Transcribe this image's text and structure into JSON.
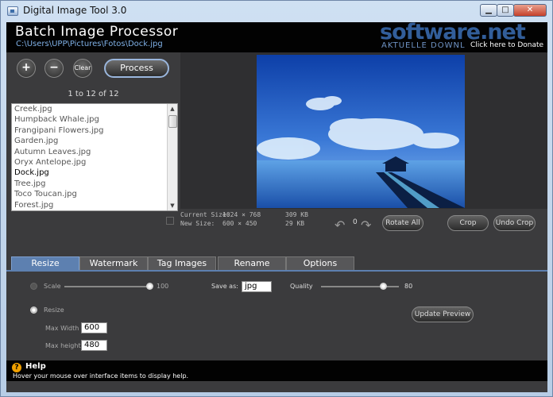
{
  "window": {
    "title": "Digital Image Tool 3.0",
    "min_glyph": "▁",
    "max_glyph": "□",
    "close_glyph": "✕"
  },
  "header": {
    "app_title": "Batch Image Processor",
    "path": "C:\\Users\\UPP\\Pictures\\Fotos\\Dock.jpg",
    "watermark": "software.net",
    "watermark_sub": "AKTUELLE DOWNL",
    "donate": "Click here to Donate"
  },
  "controls": {
    "add": "+",
    "remove": "−",
    "clear": "Clear",
    "process": "Process",
    "counter": "1 to 12 of 12"
  },
  "files": [
    "Creek.jpg",
    "Humpback Whale.jpg",
    "Frangipani Flowers.jpg",
    "Garden.jpg",
    "Autumn Leaves.jpg",
    "Oryx Antelope.jpg",
    "Dock.jpg",
    "Tree.jpg",
    "Toco Toucan.jpg",
    "Forest.jpg"
  ],
  "selected_file": "Dock.jpg",
  "info": {
    "current_label": "Current Size:",
    "current_dims": "1024 × 768",
    "current_size": "309 KB",
    "new_label": "New Size:",
    "new_dims": "600 × 450",
    "new_size": "29 KB",
    "rotation": "0",
    "rotate_all": "Rotate All",
    "crop": "Crop",
    "undo_crop": "Undo Crop"
  },
  "tabs": [
    "Resize",
    "Watermark",
    "Tag Images",
    "Rename",
    "Options"
  ],
  "active_tab": "Resize",
  "resize": {
    "scale_label": "Scale",
    "scale_value": "100",
    "scale_fraction": 1.0,
    "save_as_label": "Save as:",
    "save_as_value": "jpg",
    "quality_label": "Quality",
    "quality_value": "80",
    "quality_fraction": 0.8,
    "resize_label": "Resize",
    "max_width_label": "Max Width",
    "max_width_value": "600",
    "max_height_label": "Max height",
    "max_height_value": "480",
    "update_preview": "Update Preview"
  },
  "help": {
    "icon": "?",
    "title": "Help",
    "text": "Hover your mouse over interface items to display help."
  },
  "colors": {
    "accent": "#5d80b0",
    "panel": "#3b3b3d",
    "header": "#020202"
  }
}
